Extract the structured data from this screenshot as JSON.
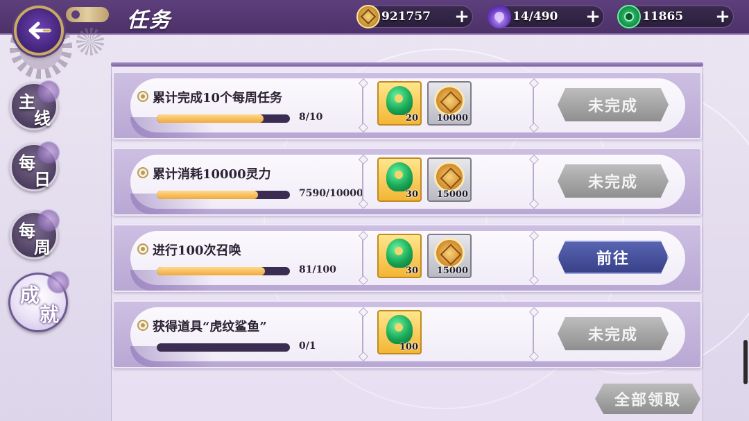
{
  "header": {
    "title": "任务",
    "back_icon": "back-arrow-icon"
  },
  "resources": [
    {
      "name": "coin",
      "icon": "coin-icon",
      "value": "921757"
    },
    {
      "name": "spirit",
      "icon": "spirit-flame-icon",
      "value": "14/490"
    },
    {
      "name": "jade",
      "icon": "jade-icon",
      "value": "11865"
    }
  ],
  "tabs": [
    {
      "line1": "主",
      "line2": "线",
      "active": false
    },
    {
      "line1": "每",
      "line2": "日",
      "active": false
    },
    {
      "line1": "每",
      "line2": "周",
      "active": false
    },
    {
      "line1": "成",
      "line2": "就",
      "active": true
    }
  ],
  "tasks": [
    {
      "title": "累计完成10个每周任务",
      "progress_text": "8/10",
      "progress": 0.8,
      "rewards": [
        {
          "type": "jade",
          "qty": "20"
        },
        {
          "type": "coin",
          "qty": "10000"
        }
      ],
      "action": "未完成",
      "action_state": "disabled"
    },
    {
      "title": "累计消耗10000灵力",
      "progress_text": "7590/10000",
      "progress": 0.759,
      "rewards": [
        {
          "type": "jade",
          "qty": "30"
        },
        {
          "type": "coin",
          "qty": "15000"
        }
      ],
      "action": "未完成",
      "action_state": "disabled"
    },
    {
      "title": "进行100次召唤",
      "progress_text": "81/100",
      "progress": 0.81,
      "rewards": [
        {
          "type": "jade",
          "qty": "30"
        },
        {
          "type": "coin",
          "qty": "15000"
        }
      ],
      "action": "前往",
      "action_state": "go"
    },
    {
      "title": "获得道具“虎纹鲨鱼”",
      "progress_text": "0/1",
      "progress": 0.0,
      "rewards": [
        {
          "type": "jade",
          "qty": "100"
        }
      ],
      "action": "未完成",
      "action_state": "disabled"
    }
  ],
  "footer": {
    "claim_all": "全部领取"
  },
  "colors": {
    "header_bg": "#5d3f7c",
    "progress_fill": "#f0a93c",
    "progress_track": "#3b2d52",
    "go_button": "#363f86",
    "disabled_button": "#8f8f8f"
  }
}
